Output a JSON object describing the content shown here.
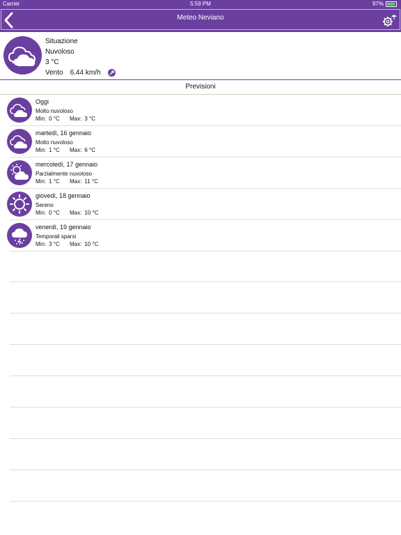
{
  "status": {
    "carrier": "Carrier",
    "time": "5:59 PM",
    "battery": "97%"
  },
  "nav": {
    "title": "Meteo Neviano"
  },
  "current": {
    "label": "Situazione",
    "condition": "Nuvoloso",
    "temp": "3 °C",
    "wind_label": "Vento",
    "wind_value": "6.44 km/h"
  },
  "forecast_title": "Previsioni",
  "forecast": [
    {
      "day": "Oggi",
      "desc": "Molto nuvoloso",
      "min_label": "Min:",
      "min": "0 °C",
      "max_label": "Max:",
      "max": "3 °C",
      "icon": "cloud-icon"
    },
    {
      "day": "martedì, 16 gennaio",
      "desc": "Molto nuvoloso",
      "min_label": "Min:",
      "min": "1 °C",
      "max_label": "Max:",
      "max": "6 °C",
      "icon": "cloud-icon"
    },
    {
      "day": "mercoledì, 17 gennaio",
      "desc": "Parzialmente nuvoloso",
      "min_label": "Min:",
      "min": "1 °C",
      "max_label": "Max:",
      "max": "11 °C",
      "icon": "partly-cloudy-icon"
    },
    {
      "day": "giovedì, 18 gennaio",
      "desc": "Sereno",
      "min_label": "Min:",
      "min": "0 °C",
      "max_label": "Max:",
      "max": "10 °C",
      "icon": "sun-icon"
    },
    {
      "day": "venerdì, 19 gennaio",
      "desc": "Temporali sparsi",
      "min_label": "Min:",
      "min": "3 °C",
      "max_label": "Max:",
      "max": "10 °C",
      "icon": "thunderstorm-icon"
    }
  ],
  "colors": {
    "brand": "#6b3fa0",
    "accent_border": "#c9b3e6"
  }
}
